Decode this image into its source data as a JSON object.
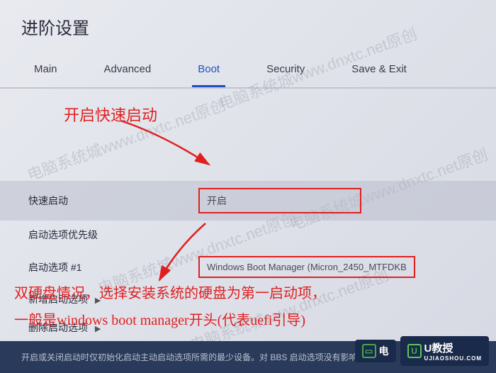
{
  "header": {
    "title": "进阶设置"
  },
  "tabs": {
    "items": [
      {
        "label": "Main"
      },
      {
        "label": "Advanced"
      },
      {
        "label": "Boot"
      },
      {
        "label": "Security"
      },
      {
        "label": "Save & Exit"
      }
    ],
    "active_index": 2
  },
  "annotations": {
    "tip1": "开启快速启动",
    "tip2_line1": "双硬盘情况，选择安装系统的硬盘为第一启动项，",
    "tip2_line2": "一般是windows boot manager开头(代表uefi引导)"
  },
  "settings": {
    "fast_boot": {
      "label": "快速启动",
      "value": "开启"
    },
    "boot_priority": {
      "label": "启动选项优先级"
    },
    "boot_option1": {
      "label": "启动选项 #1",
      "value": "Windows Boot Manager (Micron_2450_MTFDKB"
    },
    "add_boot": {
      "label": "新增启动选项"
    },
    "delete_boot": {
      "label": "删除启动选项"
    }
  },
  "status_bar": {
    "text": "开启或关闭启动时仅初始化启动主动启动选项所需的最少设备。对 BBS 启动选项没有影响。"
  },
  "watermarks": {
    "text": "电脑系统城www.dnxtc.net原创"
  },
  "badges": {
    "b1": {
      "icon_text": "电",
      "sub": ""
    },
    "b2": {
      "icon_text": "U",
      "main": "U教授",
      "sub": "UJIAOSHOU.COM"
    }
  }
}
